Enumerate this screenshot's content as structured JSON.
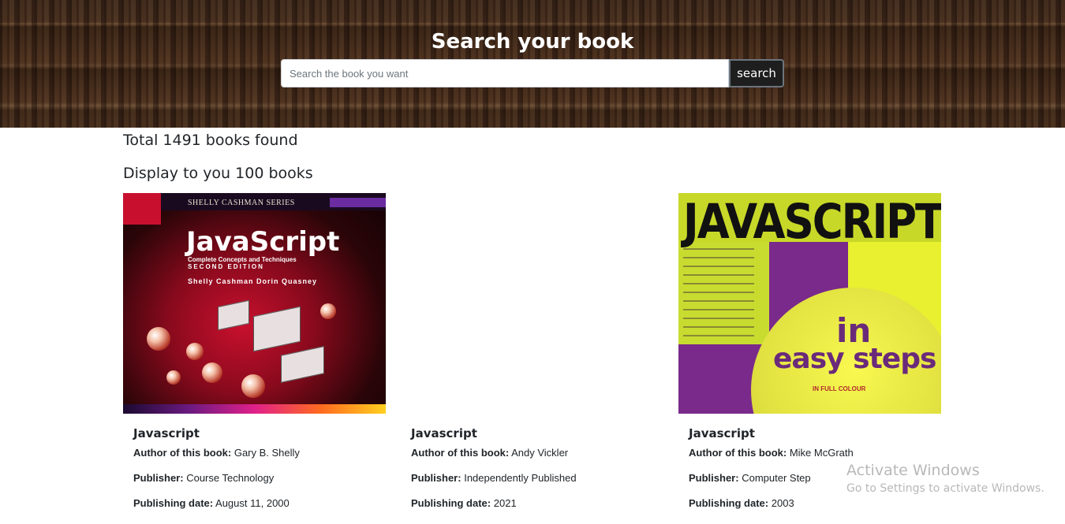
{
  "header": {
    "title": "Search your book",
    "search_placeholder": "Search the book you want",
    "search_button": "search"
  },
  "summary": {
    "total": "Total 1491 books found",
    "display": "Display to you 100 books"
  },
  "books": [
    {
      "title": "Javascript",
      "author_label": "Author of this book:",
      "author": "Gary B. Shelly",
      "publisher_label": "Publisher:",
      "publisher": "Course Technology",
      "date_label": "Publishing date:",
      "date": "August 11, 2000",
      "cover": {
        "series": "SHELLY CASHMAN SERIES",
        "title": "JavaScript",
        "subtitle": "Complete Concepts and Techniques",
        "edition": "SECOND EDITION",
        "authors": "Shelly  Cashman  Dorin  Quasney"
      }
    },
    {
      "title": "Javascript",
      "author_label": "Author of this book:",
      "author": "Andy Vickler",
      "publisher_label": "Publisher:",
      "publisher": "Independently Published",
      "date_label": "Publishing date:",
      "date": "2021"
    },
    {
      "title": "Javascript",
      "author_label": "Author of this book:",
      "author": "Mike McGrath",
      "publisher_label": "Publisher:",
      "publisher": "Computer Step",
      "date_label": "Publishing date:",
      "date": "2003",
      "cover": {
        "title": "JAVASCRIPT",
        "in": "in",
        "easy_steps": "easy steps",
        "full_colour": "IN FULL COLOUR"
      }
    }
  ],
  "watermark": {
    "line1": "Activate Windows",
    "line2": "Go to Settings to activate Windows."
  }
}
